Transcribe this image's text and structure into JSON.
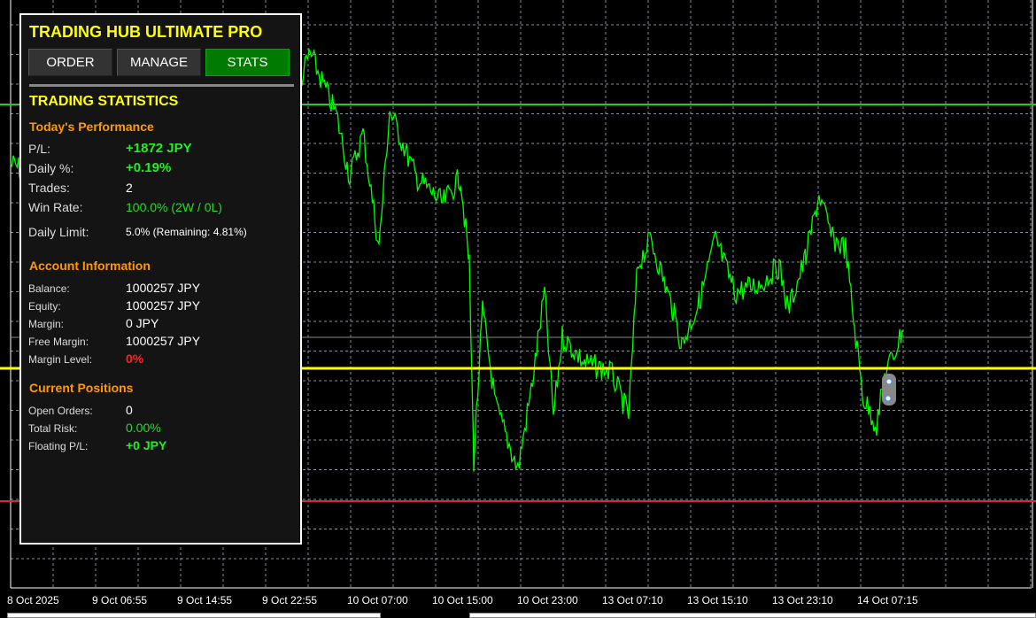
{
  "panel": {
    "title": "TRADING HUB ULTIMATE PRO",
    "tabs": [
      {
        "label": "ORDER"
      },
      {
        "label": "MANAGE"
      },
      {
        "label": "STATS"
      }
    ],
    "section_title": "TRADING STATISTICS",
    "today": {
      "header": "Today's Performance",
      "rows": [
        {
          "label": "P/L:",
          "value": "+1872 JPY"
        },
        {
          "label": "Daily %:",
          "value": "+0.19%"
        },
        {
          "label": "Trades:",
          "value": "2"
        },
        {
          "label": "Win Rate:",
          "value": "100.0% (2W / 0L)"
        },
        {
          "label": "Daily Limit:",
          "value": "5.0% (Remaining: 4.81%)"
        }
      ]
    },
    "account": {
      "header": "Account Information",
      "rows": [
        {
          "label": "Balance:",
          "value": "1000257 JPY"
        },
        {
          "label": "Equity:",
          "value": "1000257 JPY"
        },
        {
          "label": "Margin:",
          "value": "0 JPY"
        },
        {
          "label": "Free Margin:",
          "value": "1000257 JPY"
        },
        {
          "label": "Margin Level:",
          "value": "0%"
        }
      ]
    },
    "positions": {
      "header": "Current Positions",
      "rows": [
        {
          "label": "Open Orders:",
          "value": "0"
        },
        {
          "label": "Total Risk:",
          "value": "0.00%"
        },
        {
          "label": "Floating P/L:",
          "value": "+0 JPY"
        }
      ]
    }
  },
  "time_axis": [
    "8 Oct 2025",
    "9 Oct 06:55",
    "9 Oct 14:55",
    "9 Oct 22:55",
    "10 Oct 07:00",
    "10 Oct 15:00",
    "10 Oct 23:00",
    "13 Oct 07:10",
    "13 Oct 15:10",
    "13 Oct 23:10",
    "14 Oct 07:15"
  ],
  "colors": {
    "price": "#00ff00",
    "tp_line": "#22cc22",
    "sl_line": "#dd2244",
    "entry_line": "#ffff00",
    "bid_line": "#888888",
    "accent": "#ff9900"
  }
}
